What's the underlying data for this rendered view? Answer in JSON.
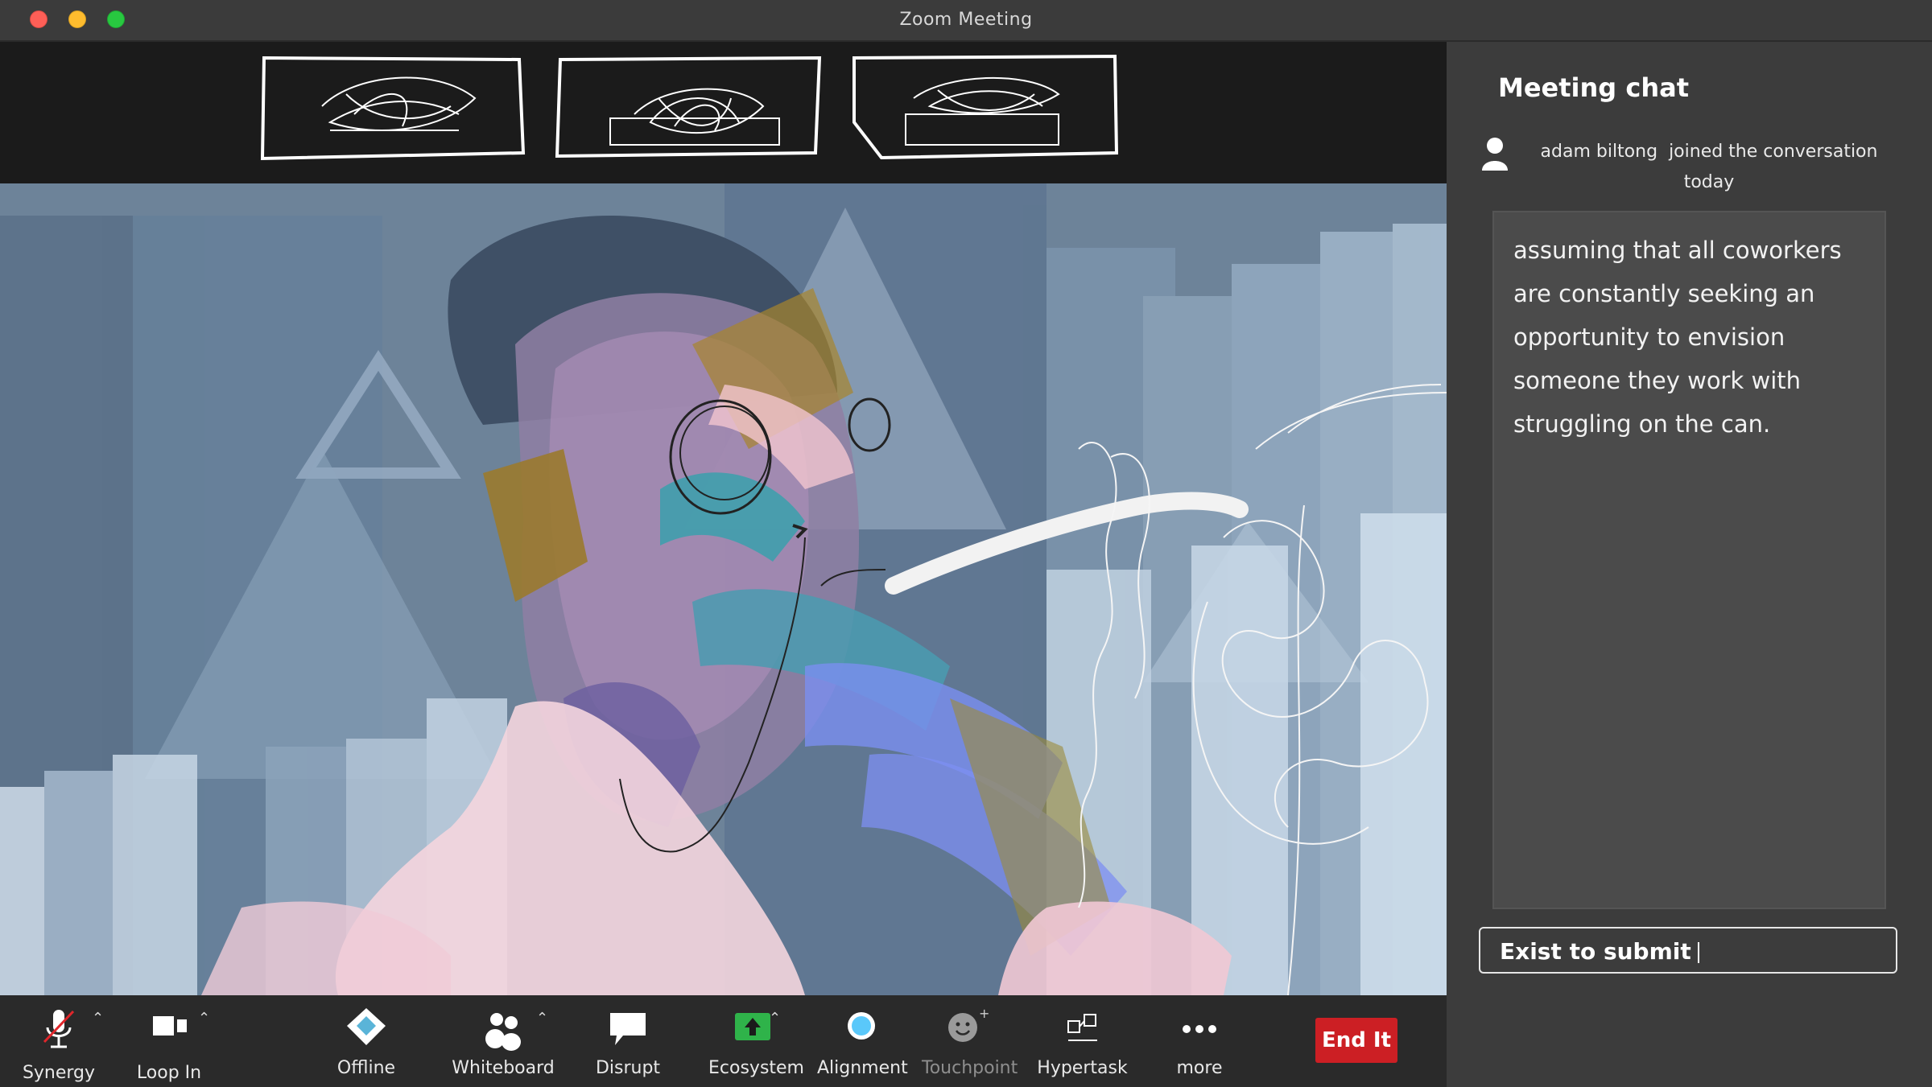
{
  "window": {
    "title": "Zoom Meeting"
  },
  "chat": {
    "title": "Meeting chat",
    "event": {
      "user": "adam biltong",
      "text": "joined the conversation today"
    },
    "message": "assuming that all coworkers are constantly seeking an opportunity to envision someone they work with struggling on the can.",
    "input_value": "Exist to submit"
  },
  "toolbar": {
    "synergy": "Synergy",
    "loop_in": "Loop In",
    "offline": "Offline",
    "whiteboard": "Whiteboard",
    "disrupt": "Disrupt",
    "ecosystem": "Ecosystem",
    "alignment": "Alignment",
    "touchpoint": "Touchpoint",
    "hypertask": "Hypertask",
    "more": "more",
    "end": "End It"
  },
  "colors": {
    "end_button": "#cc1f24",
    "ecosystem_icon": "#2fb34a",
    "alignment_icon": "#5ac8fa"
  },
  "icons": {
    "synergy": "microphone-muted-icon",
    "loop_in": "video-camera-icon",
    "offline": "shield-icon",
    "whiteboard": "participants-icon",
    "disrupt": "speech-bubble-icon",
    "ecosystem": "share-screen-icon",
    "alignment": "circle-icon",
    "touchpoint": "reaction-icon",
    "hypertask": "apps-icon",
    "more": "ellipsis-icon"
  }
}
